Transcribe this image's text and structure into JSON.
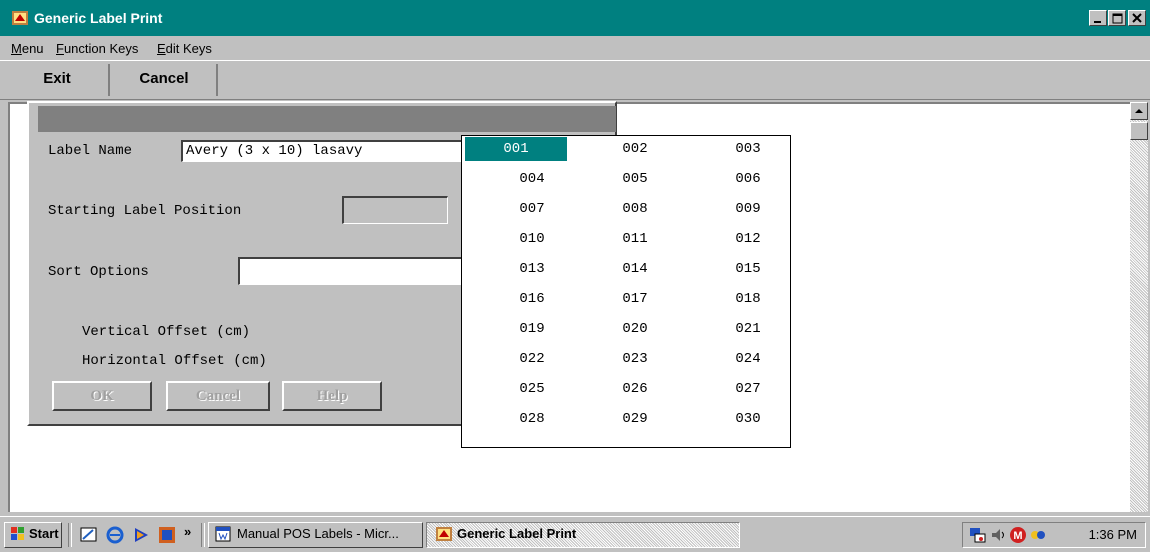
{
  "window": {
    "title": "Generic Label Print"
  },
  "menu": {
    "items": [
      {
        "label": "Menu",
        "underline": "M"
      },
      {
        "label": "Function Keys",
        "underline": "F"
      },
      {
        "label": "Edit Keys",
        "underline": "E"
      }
    ]
  },
  "toolbar": {
    "exit_label": "Exit",
    "cancel_label": "Cancel"
  },
  "dialog": {
    "label_name_label": "Label Name",
    "label_name_value": "Avery (3 x 10) lasavy",
    "starting_position_label": "Starting Label Position",
    "starting_position_value": "",
    "sort_options_label": "Sort Options",
    "sort_options_value": "",
    "vertical_offset_label": "Vertical Offset (cm)",
    "horizontal_offset_label": "Horizontal Offset (cm)",
    "ok_label": "OK",
    "cancel_label": "Cancel",
    "help_label": "Help"
  },
  "position_popup": {
    "selected": "001",
    "rows": [
      [
        "001",
        "002",
        "003"
      ],
      [
        "004",
        "005",
        "006"
      ],
      [
        "007",
        "008",
        "009"
      ],
      [
        "010",
        "011",
        "012"
      ],
      [
        "013",
        "014",
        "015"
      ],
      [
        "016",
        "017",
        "018"
      ],
      [
        "019",
        "020",
        "021"
      ],
      [
        "022",
        "023",
        "024"
      ],
      [
        "025",
        "026",
        "027"
      ],
      [
        "028",
        "029",
        "030"
      ]
    ]
  },
  "taskbar": {
    "start_label": "Start",
    "overflow_label": "»",
    "tasks": [
      {
        "label": "Manual POS Labels - Micr...",
        "icon": "word-doc-icon",
        "active": false
      },
      {
        "label": "Generic Label Print",
        "icon": "label-app-icon",
        "active": true
      }
    ],
    "clock": "1:36 PM"
  },
  "colors": {
    "titlebar": "#008080",
    "selection": "#008080",
    "face": "#c0c0c0"
  }
}
